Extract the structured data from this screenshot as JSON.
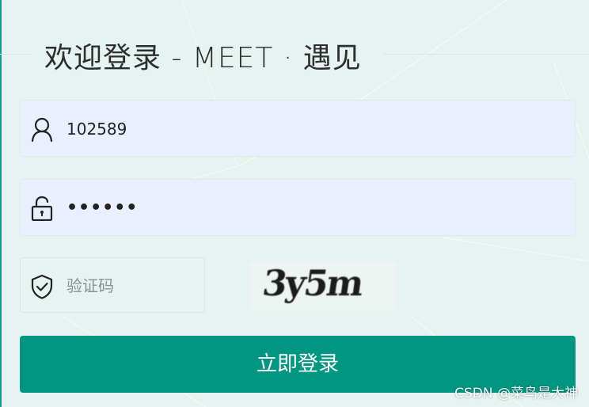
{
  "login": {
    "title": "欢迎登录  -  MEET · 遇见",
    "username": {
      "value": "102589",
      "icon": "user-icon"
    },
    "password": {
      "masked_value": "••••••",
      "icon": "unlock-icon"
    },
    "captcha": {
      "placeholder": "验证码",
      "icon": "shield-check-icon",
      "image_text": "3y5m"
    },
    "submit_label": "立即登录"
  },
  "watermark": "CSDN @菜鸟是大神",
  "colors": {
    "accent": "#009682",
    "background": "#e6f3f0",
    "input_bg": "#e9efff"
  }
}
